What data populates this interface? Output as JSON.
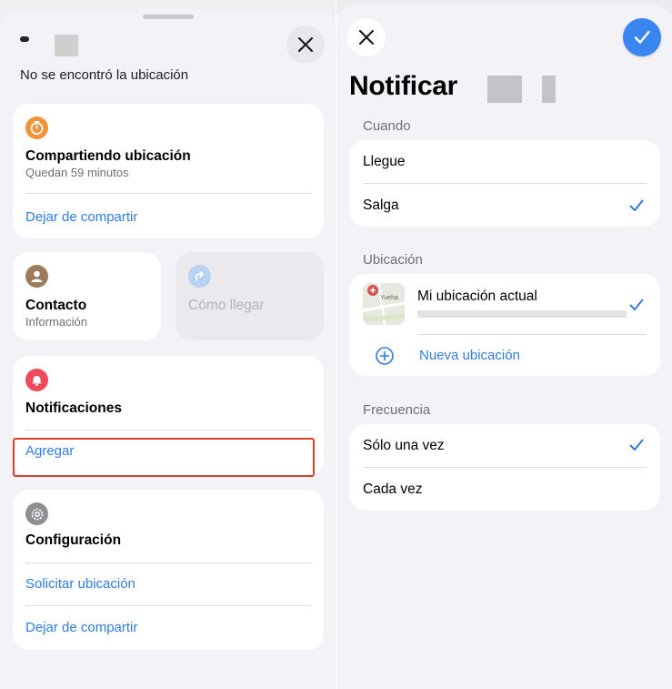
{
  "left_panel": {
    "subtitle": "No se encontró la ubicación",
    "sharing_card": {
      "title": "Compartiendo ubicación",
      "subtitle": "Quedan 59 minutos",
      "action": "Dejar de compartir"
    },
    "contact_card": {
      "title": "Contacto",
      "subtitle": "Información"
    },
    "directions_card": {
      "title": "Cómo llegar"
    },
    "notifications_card": {
      "title": "Notificaciones",
      "action": "Agregar"
    },
    "settings_card": {
      "title": "Configuración",
      "actions": [
        "Solicitar ubicación",
        "Dejar de compartir"
      ]
    }
  },
  "right_panel": {
    "title": "Notificar",
    "when": {
      "header": "Cuando",
      "options": [
        {
          "label": "Llegue",
          "selected": false
        },
        {
          "label": "Salga",
          "selected": true
        }
      ]
    },
    "location": {
      "header": "Ubicación",
      "current_label": "Mi ubicación actual",
      "current_selected": true,
      "add_label": "Nueva ubicación",
      "map_label": "Yueha"
    },
    "frequency": {
      "header": "Frecuencia",
      "options": [
        {
          "label": "Sólo una vez",
          "selected": true
        },
        {
          "label": "Cada vez",
          "selected": false
        }
      ]
    }
  },
  "colors": {
    "accent_blue": "#2f7de1",
    "done_button": "#3a86f0",
    "orange_timer": "#f0943a",
    "red_bell": "#ef4a5c",
    "brown_contact": "#9e7a5d",
    "gray_gear": "#8e8e93",
    "highlight_box": "#d9402a"
  }
}
